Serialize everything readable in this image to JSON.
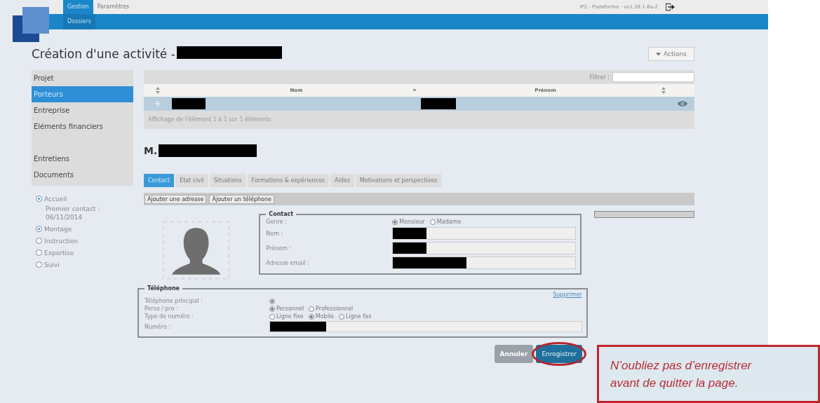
{
  "header": {
    "tabs": [
      {
        "label": "Gestion",
        "selected": true
      },
      {
        "label": "Paramètres",
        "selected": false
      }
    ],
    "subtabs": [
      {
        "label": "Dossiers",
        "selected": true
      }
    ],
    "version": "IP2 - Plateforme - vv1.28.1-6a-2"
  },
  "page": {
    "title": "Création d'une activité -",
    "title_redacted": true,
    "actions": "Actions"
  },
  "sidebar": {
    "items": [
      {
        "label": "Projet",
        "selected": false
      },
      {
        "label": "Porteurs",
        "selected": true
      },
      {
        "label": "Entreprise",
        "selected": false
      },
      {
        "label": "Eléments financiers",
        "selected": false
      },
      {
        "label": "Entretiens",
        "selected": false
      },
      {
        "label": "Documents",
        "selected": false
      }
    ]
  },
  "steps": [
    {
      "label": "Accueil",
      "checked": true,
      "note": "Premier contact : 06/11/2014"
    },
    {
      "label": "Montage",
      "checked": true
    },
    {
      "label": "Instruction",
      "checked": false
    },
    {
      "label": "Expertise",
      "checked": false
    },
    {
      "label": "Suivi",
      "checked": false
    }
  ],
  "table": {
    "filter_label": "Filtrer :",
    "columns": [
      {
        "label": "Nom",
        "sorted": true
      },
      {
        "label": "Prénom",
        "sorted": false
      }
    ],
    "rows": [
      {
        "nom_redacted": true,
        "prenom_redacted": true,
        "selected": true
      }
    ],
    "info": "Affichage de l'élément 1 à 1 sur 1 éléments"
  },
  "person": {
    "title": "M.",
    "redacted": true
  },
  "tabs": [
    {
      "label": "Contact",
      "selected": true
    },
    {
      "label": "Etat civil",
      "selected": false
    },
    {
      "label": "Situations",
      "selected": false
    },
    {
      "label": "Formations & expériences",
      "selected": false
    },
    {
      "label": "Aides",
      "selected": false
    },
    {
      "label": "Motivations et perspectives",
      "selected": false
    }
  ],
  "toolbar": [
    "Ajouter une adresse",
    "Ajouter un téléphone"
  ],
  "contact": {
    "legend": "Contact",
    "genre": {
      "label": "Genre :",
      "options": [
        {
          "label": "Monsieur",
          "selected": true
        },
        {
          "label": "Madame",
          "selected": false
        }
      ]
    },
    "fields": [
      {
        "label": "Nom :",
        "redacted": true
      },
      {
        "label": "Prénom :",
        "redacted": true
      },
      {
        "label": "Adresse email :",
        "redacted": true
      }
    ]
  },
  "telephone": {
    "legend": "Téléphone",
    "delete": "Supprimer",
    "rows": [
      {
        "kind": "radio",
        "label": "Téléphone principal :",
        "options": [
          {
            "selected": true
          }
        ]
      },
      {
        "kind": "radio",
        "label": "Perso / pro :",
        "options": [
          {
            "label": "Personnel",
            "selected": true
          },
          {
            "label": "Professionnel",
            "selected": false
          }
        ]
      },
      {
        "kind": "radio",
        "label": "Type de numéro :",
        "options": [
          {
            "label": "Ligne fixe",
            "selected": false
          },
          {
            "label": "Mobile",
            "selected": true
          },
          {
            "label": "Ligne fax",
            "selected": false
          }
        ]
      },
      {
        "kind": "field",
        "label": "Numéro :",
        "redacted": true
      }
    ]
  },
  "buttons": [
    {
      "label": "Annuler",
      "kind": "secondary",
      "circled": false
    },
    {
      "label": "Enregistrer",
      "kind": "primary",
      "circled": true
    }
  ],
  "callout": {
    "text": "N’oubliez pas d’enregistrer avant de quitter la page."
  }
}
